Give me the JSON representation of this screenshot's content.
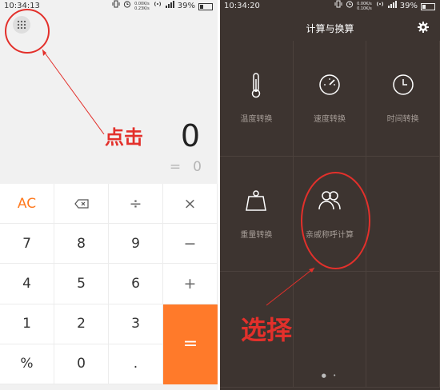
{
  "left_phone": {
    "status_bar": {
      "time": "10:34:13",
      "net_up": "0.00K/s",
      "net_down": "0.23K/s",
      "battery": "39%"
    },
    "display": {
      "result": "0",
      "eq_sign": "=",
      "eq_value": "0"
    },
    "keys": [
      {
        "label": "AC",
        "type": "ac",
        "name": "key-ac"
      },
      {
        "label": "⌫",
        "type": "backspace",
        "name": "key-backspace"
      },
      {
        "label": "÷",
        "type": "op",
        "name": "key-divide"
      },
      {
        "label": "×",
        "type": "op",
        "name": "key-multiply"
      },
      {
        "label": "7",
        "type": "num",
        "name": "key-7"
      },
      {
        "label": "8",
        "type": "num",
        "name": "key-8"
      },
      {
        "label": "9",
        "type": "num",
        "name": "key-9"
      },
      {
        "label": "−",
        "type": "op",
        "name": "key-minus"
      },
      {
        "label": "4",
        "type": "num",
        "name": "key-4"
      },
      {
        "label": "5",
        "type": "num",
        "name": "key-5"
      },
      {
        "label": "6",
        "type": "num",
        "name": "key-6"
      },
      {
        "label": "+",
        "type": "op",
        "name": "key-plus"
      },
      {
        "label": "1",
        "type": "num",
        "name": "key-1"
      },
      {
        "label": "2",
        "type": "num",
        "name": "key-2"
      },
      {
        "label": "3",
        "type": "num",
        "name": "key-3"
      },
      {
        "label": "=",
        "type": "equals",
        "name": "key-equals"
      },
      {
        "label": "%",
        "type": "num",
        "name": "key-percent"
      },
      {
        "label": "0",
        "type": "num",
        "name": "key-0"
      },
      {
        "label": ".",
        "type": "num",
        "name": "key-decimal"
      }
    ],
    "annotation": {
      "label": "点击",
      "color": "#e3302b"
    }
  },
  "right_phone": {
    "status_bar": {
      "time": "10:34:20",
      "net_up": "0.00K/s",
      "net_down": "0.10K/s",
      "battery": "39%"
    },
    "title": "计算与换算",
    "tiles": [
      {
        "label": "温度转换",
        "icon": "thermometer-icon"
      },
      {
        "label": "速度转换",
        "icon": "speedometer-icon"
      },
      {
        "label": "时间转换",
        "icon": "clock-icon"
      },
      {
        "label": "重量转换",
        "icon": "weight-icon"
      },
      {
        "label": "亲戚称呼计算",
        "icon": "relatives-icon"
      },
      {
        "label": "",
        "icon": ""
      },
      {
        "label": "",
        "icon": ""
      },
      {
        "label": "",
        "icon": ""
      },
      {
        "label": "",
        "icon": ""
      }
    ],
    "annotation": {
      "label": "选择",
      "color": "#e3302b"
    }
  },
  "colors": {
    "accent_orange": "#ff7a2a",
    "annotation_red": "#e3302b",
    "converter_bg": "#3d3430"
  }
}
